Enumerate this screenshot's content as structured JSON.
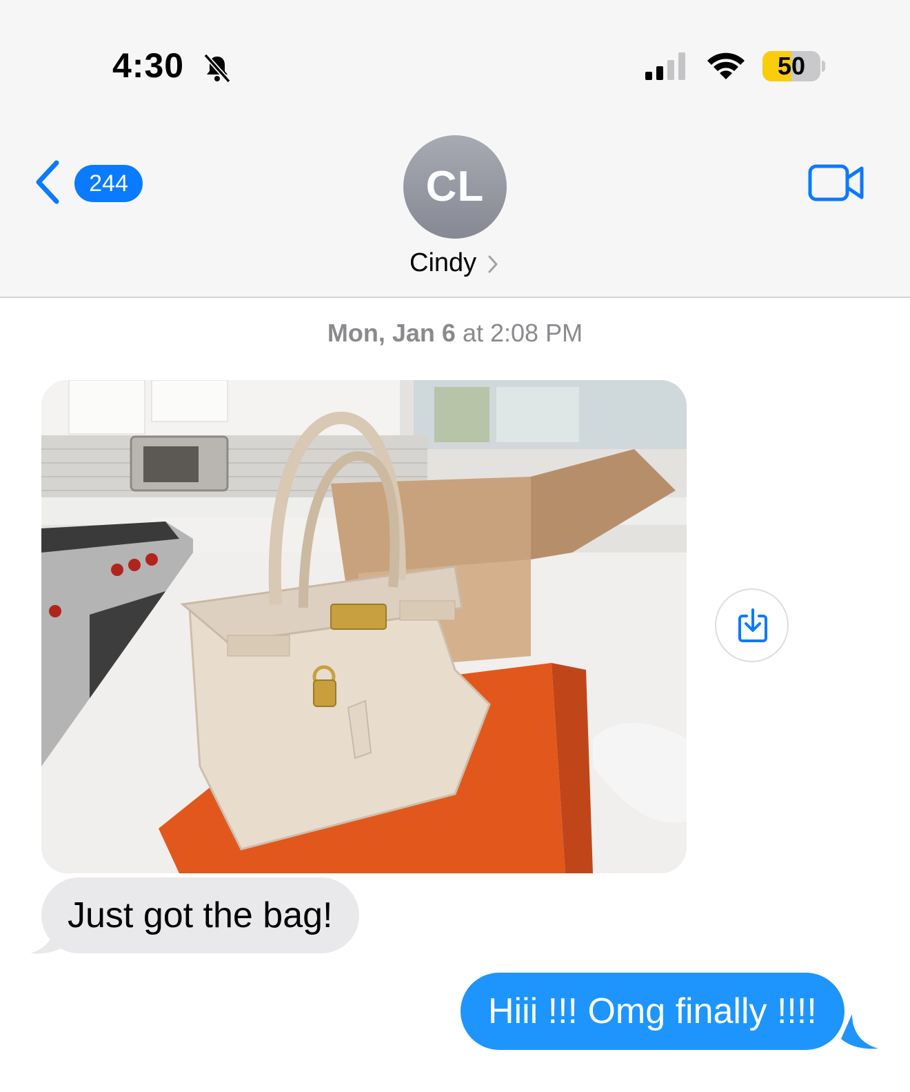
{
  "status_bar": {
    "time": "4:30",
    "battery_level": "50",
    "battery_fraction": 0.5,
    "icons": [
      "bell-slash-icon",
      "signal-icon",
      "wifi-icon",
      "battery-icon"
    ],
    "colors": {
      "battery_fill": "#f9cd0c"
    }
  },
  "nav": {
    "back_icon": "chevron-left-icon",
    "unread_count": "244",
    "avatar_initials": "CL",
    "contact_name": "Cindy",
    "video_icon": "video-camera-icon",
    "colors": {
      "accent": "#0a7aff"
    }
  },
  "conversation": {
    "timestamp_day": "Mon, Jan 6",
    "timestamp_at": "at",
    "timestamp_time": "2:08 PM",
    "incoming": [
      {
        "type": "image"
      },
      {
        "type": "text",
        "text": "Just got the bag!"
      }
    ],
    "save_icon": "save-download-icon",
    "outgoing": [
      {
        "type": "text",
        "text": "Hiii !!! Omg finally !!!!"
      }
    ],
    "colors": {
      "incoming_bubble": "#e9e9eb",
      "outgoing_bubble": "#1d95fc"
    }
  }
}
